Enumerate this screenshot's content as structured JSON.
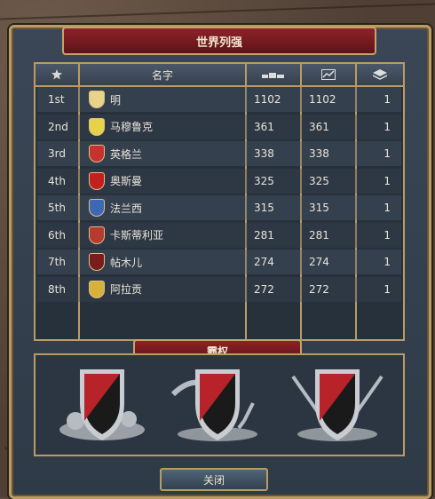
{
  "window": {
    "title": "世界列强"
  },
  "table": {
    "headers": {
      "rank_icon": "star-icon",
      "name": "名字",
      "score_icon": "bars-icon",
      "trend_icon": "chart-icon",
      "count_icon": "stack-icon"
    },
    "rows": [
      {
        "rank": "1st",
        "name": "明",
        "score": "1102",
        "total": "1102",
        "count": "1",
        "shield_color": "#e7d38a"
      },
      {
        "rank": "2nd",
        "name": "马穆鲁克",
        "score": "361",
        "total": "361",
        "count": "1",
        "shield_color": "#e7d34a"
      },
      {
        "rank": "3rd",
        "name": "英格兰",
        "score": "338",
        "total": "338",
        "count": "1",
        "shield_color": "#c8322e"
      },
      {
        "rank": "4th",
        "name": "奥斯曼",
        "score": "325",
        "total": "325",
        "count": "1",
        "shield_color": "#c21f1f"
      },
      {
        "rank": "5th",
        "name": "法兰西",
        "score": "315",
        "total": "315",
        "count": "1",
        "shield_color": "#3d68b6"
      },
      {
        "rank": "6th",
        "name": "卡斯蒂利亚",
        "score": "281",
        "total": "281",
        "count": "1",
        "shield_color": "#b63a2f"
      },
      {
        "rank": "7th",
        "name": "帖木儿",
        "score": "274",
        "total": "274",
        "count": "1",
        "shield_color": "#7a1c1c"
      },
      {
        "rank": "8th",
        "name": "阿拉贡",
        "score": "272",
        "total": "272",
        "count": "1",
        "shield_color": "#d8b13a"
      }
    ]
  },
  "hegemony": {
    "title": "霸权",
    "emblems": [
      {
        "icon": "economic-hegemony-icon"
      },
      {
        "icon": "naval-hegemony-icon"
      },
      {
        "icon": "military-hegemony-icon"
      }
    ]
  },
  "footer": {
    "close_label": "关闭"
  },
  "colors": {
    "panel": "#2f3a47",
    "gold": "#b99c63",
    "banner": "#8d2228"
  }
}
